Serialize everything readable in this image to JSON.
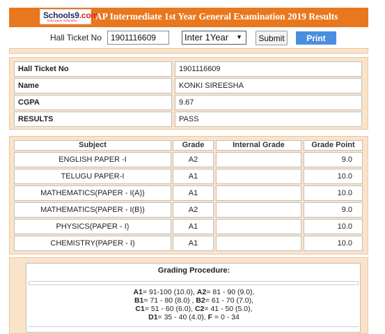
{
  "header": {
    "logo_text": "Schools9",
    "logo_suffix": ".com",
    "logo_tagline": "Education Solutions",
    "title": "AP Intermediate 1st Year General Examination 2019 Results"
  },
  "search": {
    "hall_ticket_label": "Hall Ticket No",
    "hall_ticket_value": "1901116609",
    "year_selected": "Inter 1Year",
    "submit_label": "Submit",
    "print_label": "Print"
  },
  "student": {
    "rows": [
      {
        "label": "Hall Ticket No",
        "value": "1901116609"
      },
      {
        "label": "Name",
        "value": "KONKI SIREESHA"
      },
      {
        "label": "CGPA",
        "value": "9.67"
      },
      {
        "label": "RESULTS",
        "value": "PASS"
      }
    ]
  },
  "marks": {
    "headers": [
      "Subject",
      "Grade",
      "Internal Grade",
      "Grade Point"
    ],
    "rows": [
      {
        "subject": "ENGLISH PAPER -I",
        "grade": "A2",
        "internal": "",
        "point": "9.0"
      },
      {
        "subject": "TELUGU PAPER-I",
        "grade": "A1",
        "internal": "",
        "point": "10.0"
      },
      {
        "subject": "MATHEMATICS(PAPER - I(A))",
        "grade": "A1",
        "internal": "",
        "point": "10.0"
      },
      {
        "subject": "MATHEMATICS(PAPER - I(B))",
        "grade": "A2",
        "internal": "",
        "point": "9.0"
      },
      {
        "subject": "PHYSICS(PAPER - I)",
        "grade": "A1",
        "internal": "",
        "point": "10.0"
      },
      {
        "subject": "CHEMISTRY(PAPER - I)",
        "grade": "A1",
        "internal": "",
        "point": "10.0"
      }
    ]
  },
  "grading": {
    "title": "Grading Procedure:",
    "lines": [
      [
        {
          "g": "A1",
          "r": "= 91-100 (10.0), "
        },
        {
          "g": "A2",
          "r": "= 81 - 90 (9.0),"
        }
      ],
      [
        {
          "g": "B1",
          "r": "= 71 - 80 (8.0) , "
        },
        {
          "g": "B2",
          "r": "= 61 - 70 (7.0),"
        }
      ],
      [
        {
          "g": "C1",
          "r": "= 51 - 60 (6.0), "
        },
        {
          "g": "C2",
          "r": "= 41 - 50 (5.0),"
        }
      ],
      [
        {
          "g": "D1",
          "r": "= 35 - 40 (4.0), "
        },
        {
          "g": "F",
          "r": " = 0 - 34"
        }
      ]
    ]
  },
  "colors": {
    "header_bg": "#e8771e",
    "panel_bg": "#fbe3c9",
    "print_btn": "#4a8fdf"
  }
}
